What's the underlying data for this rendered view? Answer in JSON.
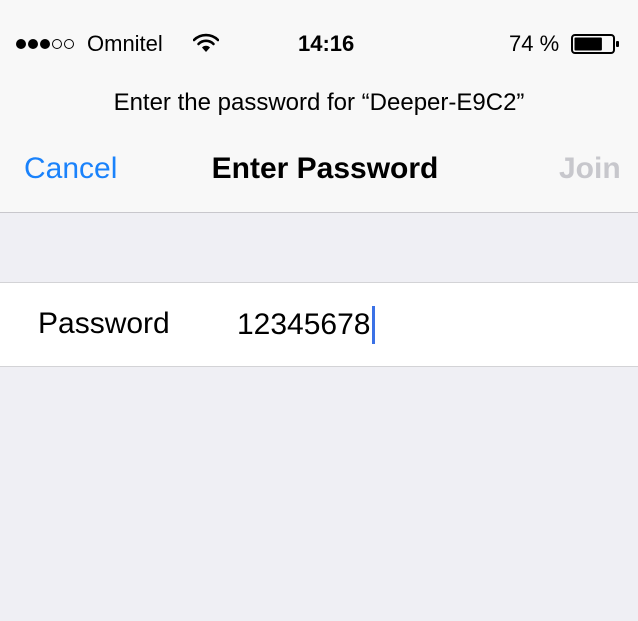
{
  "status_bar": {
    "signal_bars_filled": 3,
    "signal_bars_total": 5,
    "carrier": "Omnitel",
    "wifi_icon": "wifi-icon",
    "time": "14:16",
    "battery_text": "74 %",
    "battery_level": 0.74,
    "battery_icon": "battery-icon"
  },
  "prompt": "Enter the password for “Deeper-E9C2”",
  "nav_bar": {
    "cancel_label": "Cancel",
    "title": "Enter Password",
    "join_label": "Join"
  },
  "form": {
    "password_label": "Password",
    "password_value": "12345678"
  },
  "colors": {
    "accent": "#1a82fb",
    "disabled": "#c7c7cc",
    "caret": "#3b71e6",
    "background": "#efeff4"
  }
}
